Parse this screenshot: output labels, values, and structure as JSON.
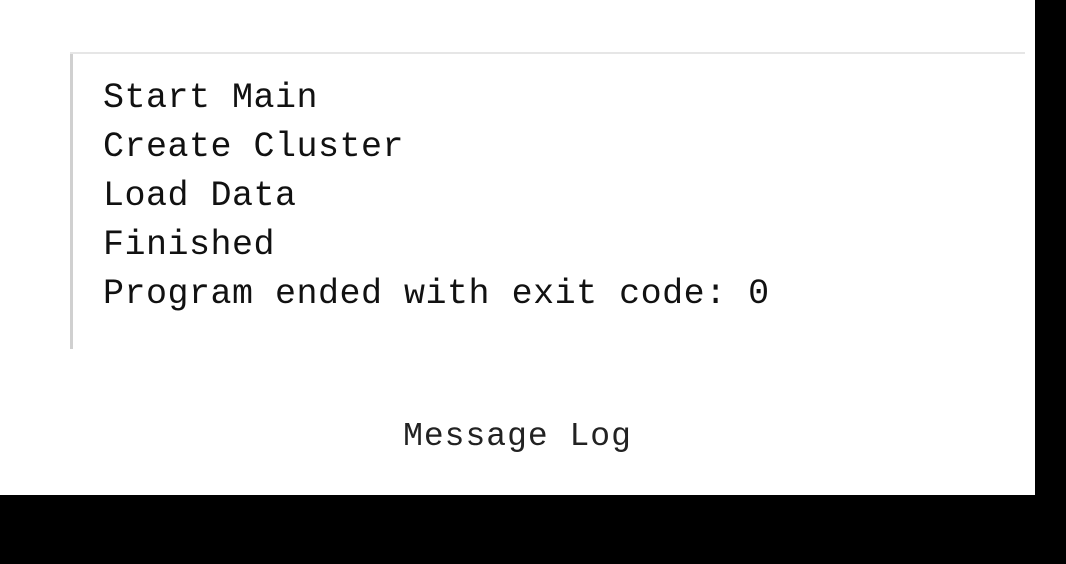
{
  "log": {
    "lines": [
      "Start Main",
      "Create Cluster",
      "Load Data",
      "Finished",
      "Program ended with exit code: 0"
    ]
  },
  "caption": "Message Log"
}
